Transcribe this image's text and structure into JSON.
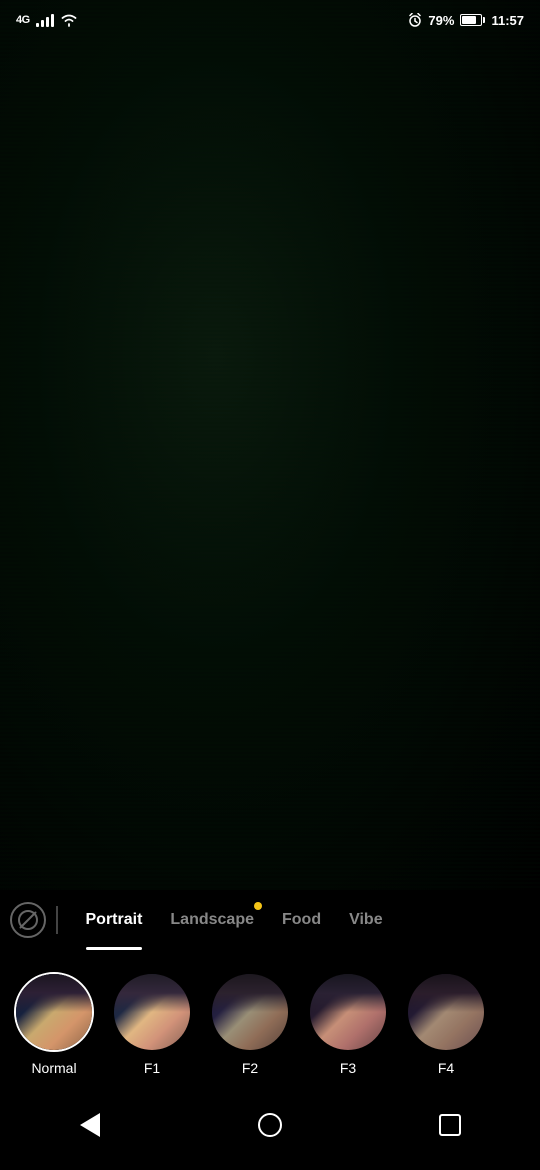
{
  "statusBar": {
    "network": "4G",
    "battery_percent": "79%",
    "time": "11:57"
  },
  "filterTabs": {
    "noFilter": "no-filter",
    "items": [
      {
        "id": "portrait",
        "label": "Portrait",
        "active": true,
        "dot": false
      },
      {
        "id": "landscape",
        "label": "Landscape",
        "active": false,
        "dot": true
      },
      {
        "id": "food",
        "label": "Food",
        "active": false,
        "dot": false
      },
      {
        "id": "vibe",
        "label": "Vibe",
        "active": false,
        "dot": false
      }
    ]
  },
  "filterItems": [
    {
      "id": "normal",
      "label": "Normal",
      "selected": true
    },
    {
      "id": "f1",
      "label": "F1",
      "selected": false
    },
    {
      "id": "f2",
      "label": "F2",
      "selected": false
    },
    {
      "id": "f3",
      "label": "F3",
      "selected": false
    },
    {
      "id": "f4",
      "label": "F4",
      "selected": false
    }
  ],
  "navBar": {
    "back": "back",
    "home": "home",
    "recent": "recent"
  }
}
